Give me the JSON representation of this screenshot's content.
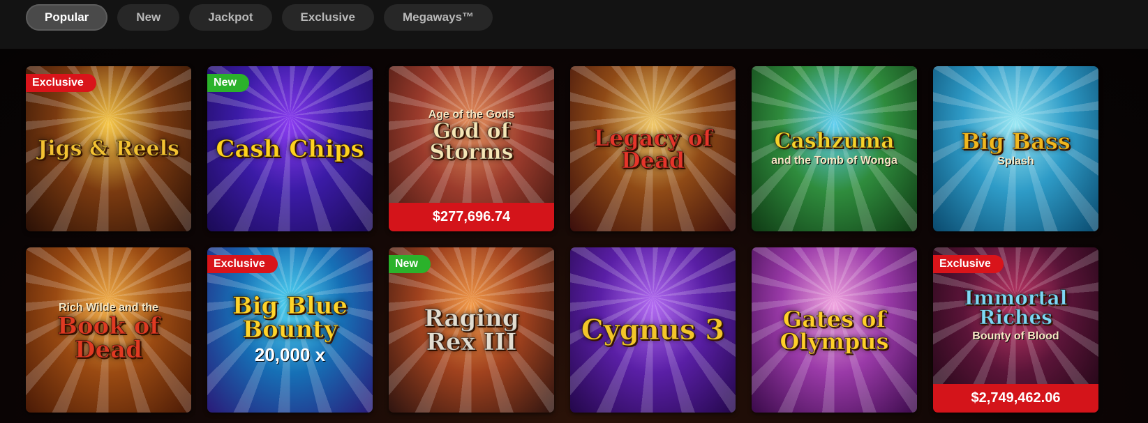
{
  "filter_tabs": [
    {
      "label": "Popular",
      "active": true
    },
    {
      "label": "New",
      "active": false
    },
    {
      "label": "Jackpot",
      "active": false
    },
    {
      "label": "Exclusive",
      "active": false
    },
    {
      "label": "Megaways™",
      "active": false
    }
  ],
  "badges": {
    "exclusive": "Exclusive",
    "new": "New"
  },
  "games": [
    {
      "title": "Jigs & Reels",
      "subtitle": "",
      "badge": "exclusive",
      "jackpot": "",
      "colors": [
        "#f7c84a",
        "#7a3a10",
        "#2a1006"
      ],
      "title_color": "#f4c232"
    },
    {
      "title": "Cash Chips",
      "subtitle": "",
      "badge": "new",
      "jackpot": "",
      "colors": [
        "#8a3cf0",
        "#3b1ba6",
        "#1a0a55"
      ],
      "title_color": "#ffd21f"
    },
    {
      "title": "God of Storms",
      "subtitle": "Age of the Gods",
      "badge": "",
      "jackpot": "$277,696.74",
      "colors": [
        "#e7935f",
        "#9b3b2c",
        "#3d1610"
      ],
      "title_color": "#f6e6b6"
    },
    {
      "title": "Legacy of Dead",
      "subtitle": "",
      "badge": "",
      "jackpot": "",
      "colors": [
        "#f1c96a",
        "#8f4a16",
        "#3a0e0c"
      ],
      "title_color": "#e5352a"
    },
    {
      "title": "Cashzuma",
      "subtitle": "and the Tomb of Wonga",
      "badge": "",
      "jackpot": "",
      "colors": [
        "#64d0f2",
        "#2f8c3d",
        "#0f3a14"
      ],
      "title_color": "#f5d22b"
    },
    {
      "title": "Big Bass",
      "subtitle": "Splash",
      "badge": "",
      "jackpot": "",
      "colors": [
        "#9be8f4",
        "#2e9bc7",
        "#0a4a6e"
      ],
      "title_color": "#f1b71f"
    },
    {
      "title": "Book of Dead",
      "subtitle": "Rich Wilde and the",
      "badge": "",
      "jackpot": "",
      "colors": [
        "#f3b04a",
        "#9a4a12",
        "#4a1a06"
      ],
      "title_color": "#e03a22"
    },
    {
      "title": "Big Blue Bounty",
      "subtitle": "20,000 x",
      "badge": "exclusive",
      "jackpot": "",
      "colors": [
        "#53d7f5",
        "#1670b6",
        "#2a1a78"
      ],
      "title_color": "#ffd42a"
    },
    {
      "title": "Raging Rex III",
      "subtitle": "",
      "badge": "new",
      "jackpot": "",
      "colors": [
        "#f29a4a",
        "#a1421e",
        "#2e1410"
      ],
      "title_color": "#e3ddd0"
    },
    {
      "title": "Cygnus 3",
      "subtitle": "",
      "badge": "",
      "jackpot": "",
      "colors": [
        "#b36cf2",
        "#5a1fa6",
        "#23074a"
      ],
      "title_color": "#f3c52a"
    },
    {
      "title": "Gates of Olympus",
      "subtitle": "",
      "badge": "",
      "jackpot": "",
      "colors": [
        "#f1a6e0",
        "#9a3aa8",
        "#3a0a4a"
      ],
      "title_color": "#ffcf2a"
    },
    {
      "title": "Immortal Riches",
      "subtitle": "Bounty of Blood",
      "badge": "exclusive",
      "jackpot": "$2,749,462.06",
      "colors": [
        "#c43a6a",
        "#5a1438",
        "#1a0512"
      ],
      "title_color": "#7fd8f4"
    }
  ]
}
